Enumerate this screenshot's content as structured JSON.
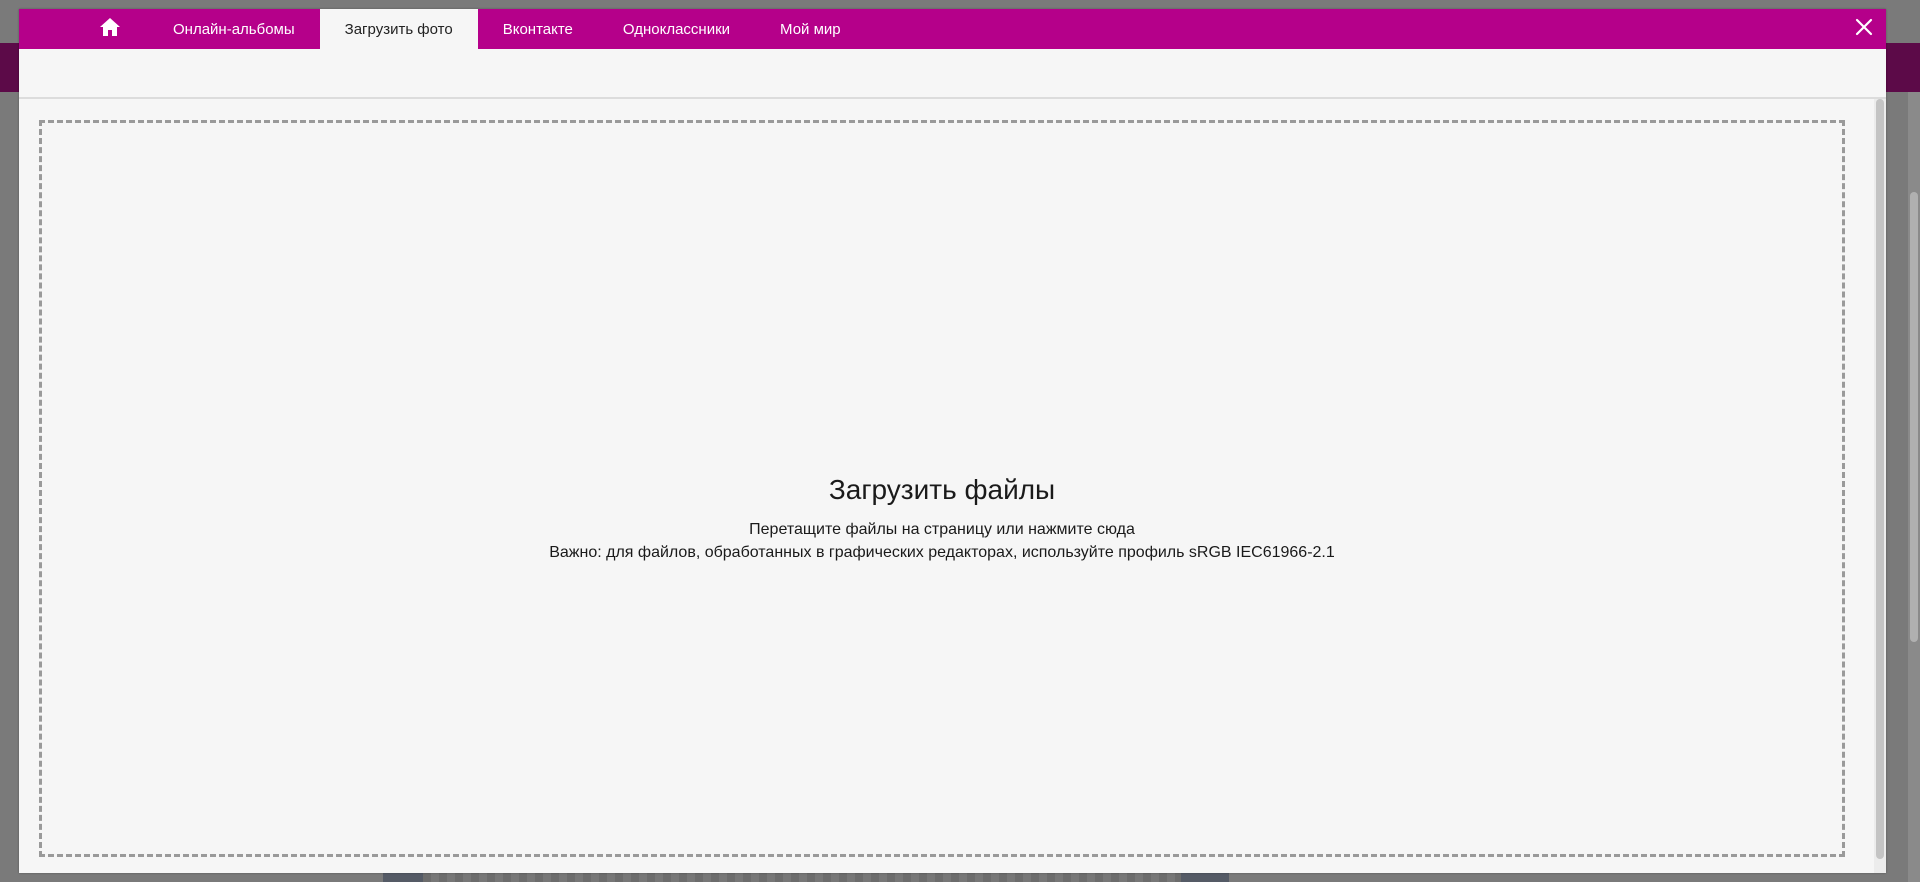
{
  "tabs": {
    "home_icon": "home-icon",
    "items": [
      {
        "label": "Онлайн-альбомы"
      },
      {
        "label": "Загрузить фото",
        "active": true
      },
      {
        "label": "Вконтакте"
      },
      {
        "label": "Одноклассники"
      },
      {
        "label": "Мой мир"
      }
    ],
    "close_icon": "close-icon"
  },
  "dropzone": {
    "title": "Загрузить файлы",
    "hint": "Перетащите файлы на страницу или нажмите сюда",
    "note": "Важно: для файлов, обработанных в графических редакторах, используйте профиль sRGB IEC61966-2.1"
  },
  "colors": {
    "accent": "#b5008a",
    "panel": "#f6f6f6",
    "overlay": "#7a7a7a"
  }
}
